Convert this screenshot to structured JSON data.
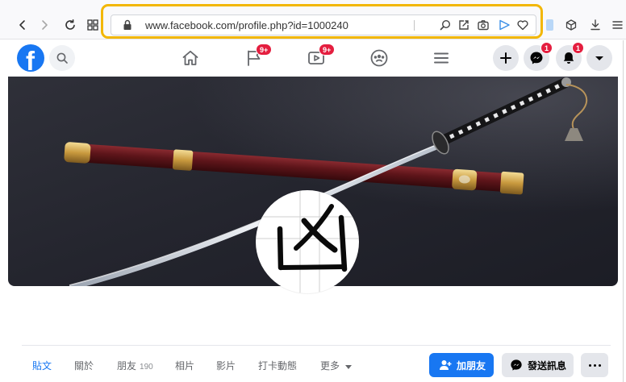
{
  "colors": {
    "facebook_blue": "#1877f2",
    "address_highlight": "#f2b705",
    "notification_badge": "#e41e3f",
    "button_gray": "#e4e6eb"
  },
  "browser": {
    "nav_icons": [
      "back-icon",
      "forward-icon",
      "reload-icon",
      "apps-grid-icon"
    ],
    "address_bar": {
      "url": "www.facebook.com/profile.php?id=1000240",
      "icons": [
        "lock-icon",
        "zoom-icon",
        "share-edit-icon",
        "screenshot-camera-icon",
        "send-icon",
        "favorite-heart-icon"
      ]
    },
    "toolbar_icons": [
      "extension-icon",
      "cube-icon",
      "download-icon",
      "menu-icon"
    ]
  },
  "facebook_header": {
    "logo": "f",
    "search_icon": "search-icon",
    "nav": [
      {
        "icon": "home-icon"
      },
      {
        "icon": "flag-icon",
        "badge": "9+"
      },
      {
        "icon": "video-icon",
        "badge": "9+"
      },
      {
        "icon": "groups-icon"
      },
      {
        "icon": "hamburger-menu-icon"
      }
    ],
    "actions": [
      {
        "icon": "plus-icon"
      },
      {
        "icon": "messenger-icon",
        "badge": "1"
      },
      {
        "icon": "bell-icon",
        "badge": "1"
      },
      {
        "icon": "caret-down-icon"
      }
    ]
  },
  "profile": {
    "picture_lettering": "凶",
    "tabs": [
      {
        "label": "貼文",
        "active": true
      },
      {
        "label": "關於"
      },
      {
        "label": "朋友",
        "count": "190"
      },
      {
        "label": "相片"
      },
      {
        "label": "影片"
      },
      {
        "label": "打卡動態"
      },
      {
        "label": "更多"
      }
    ],
    "buttons": {
      "add_friend": "加朋友",
      "send_message": "發送訊息",
      "more_icon": "more-options-icon"
    }
  }
}
